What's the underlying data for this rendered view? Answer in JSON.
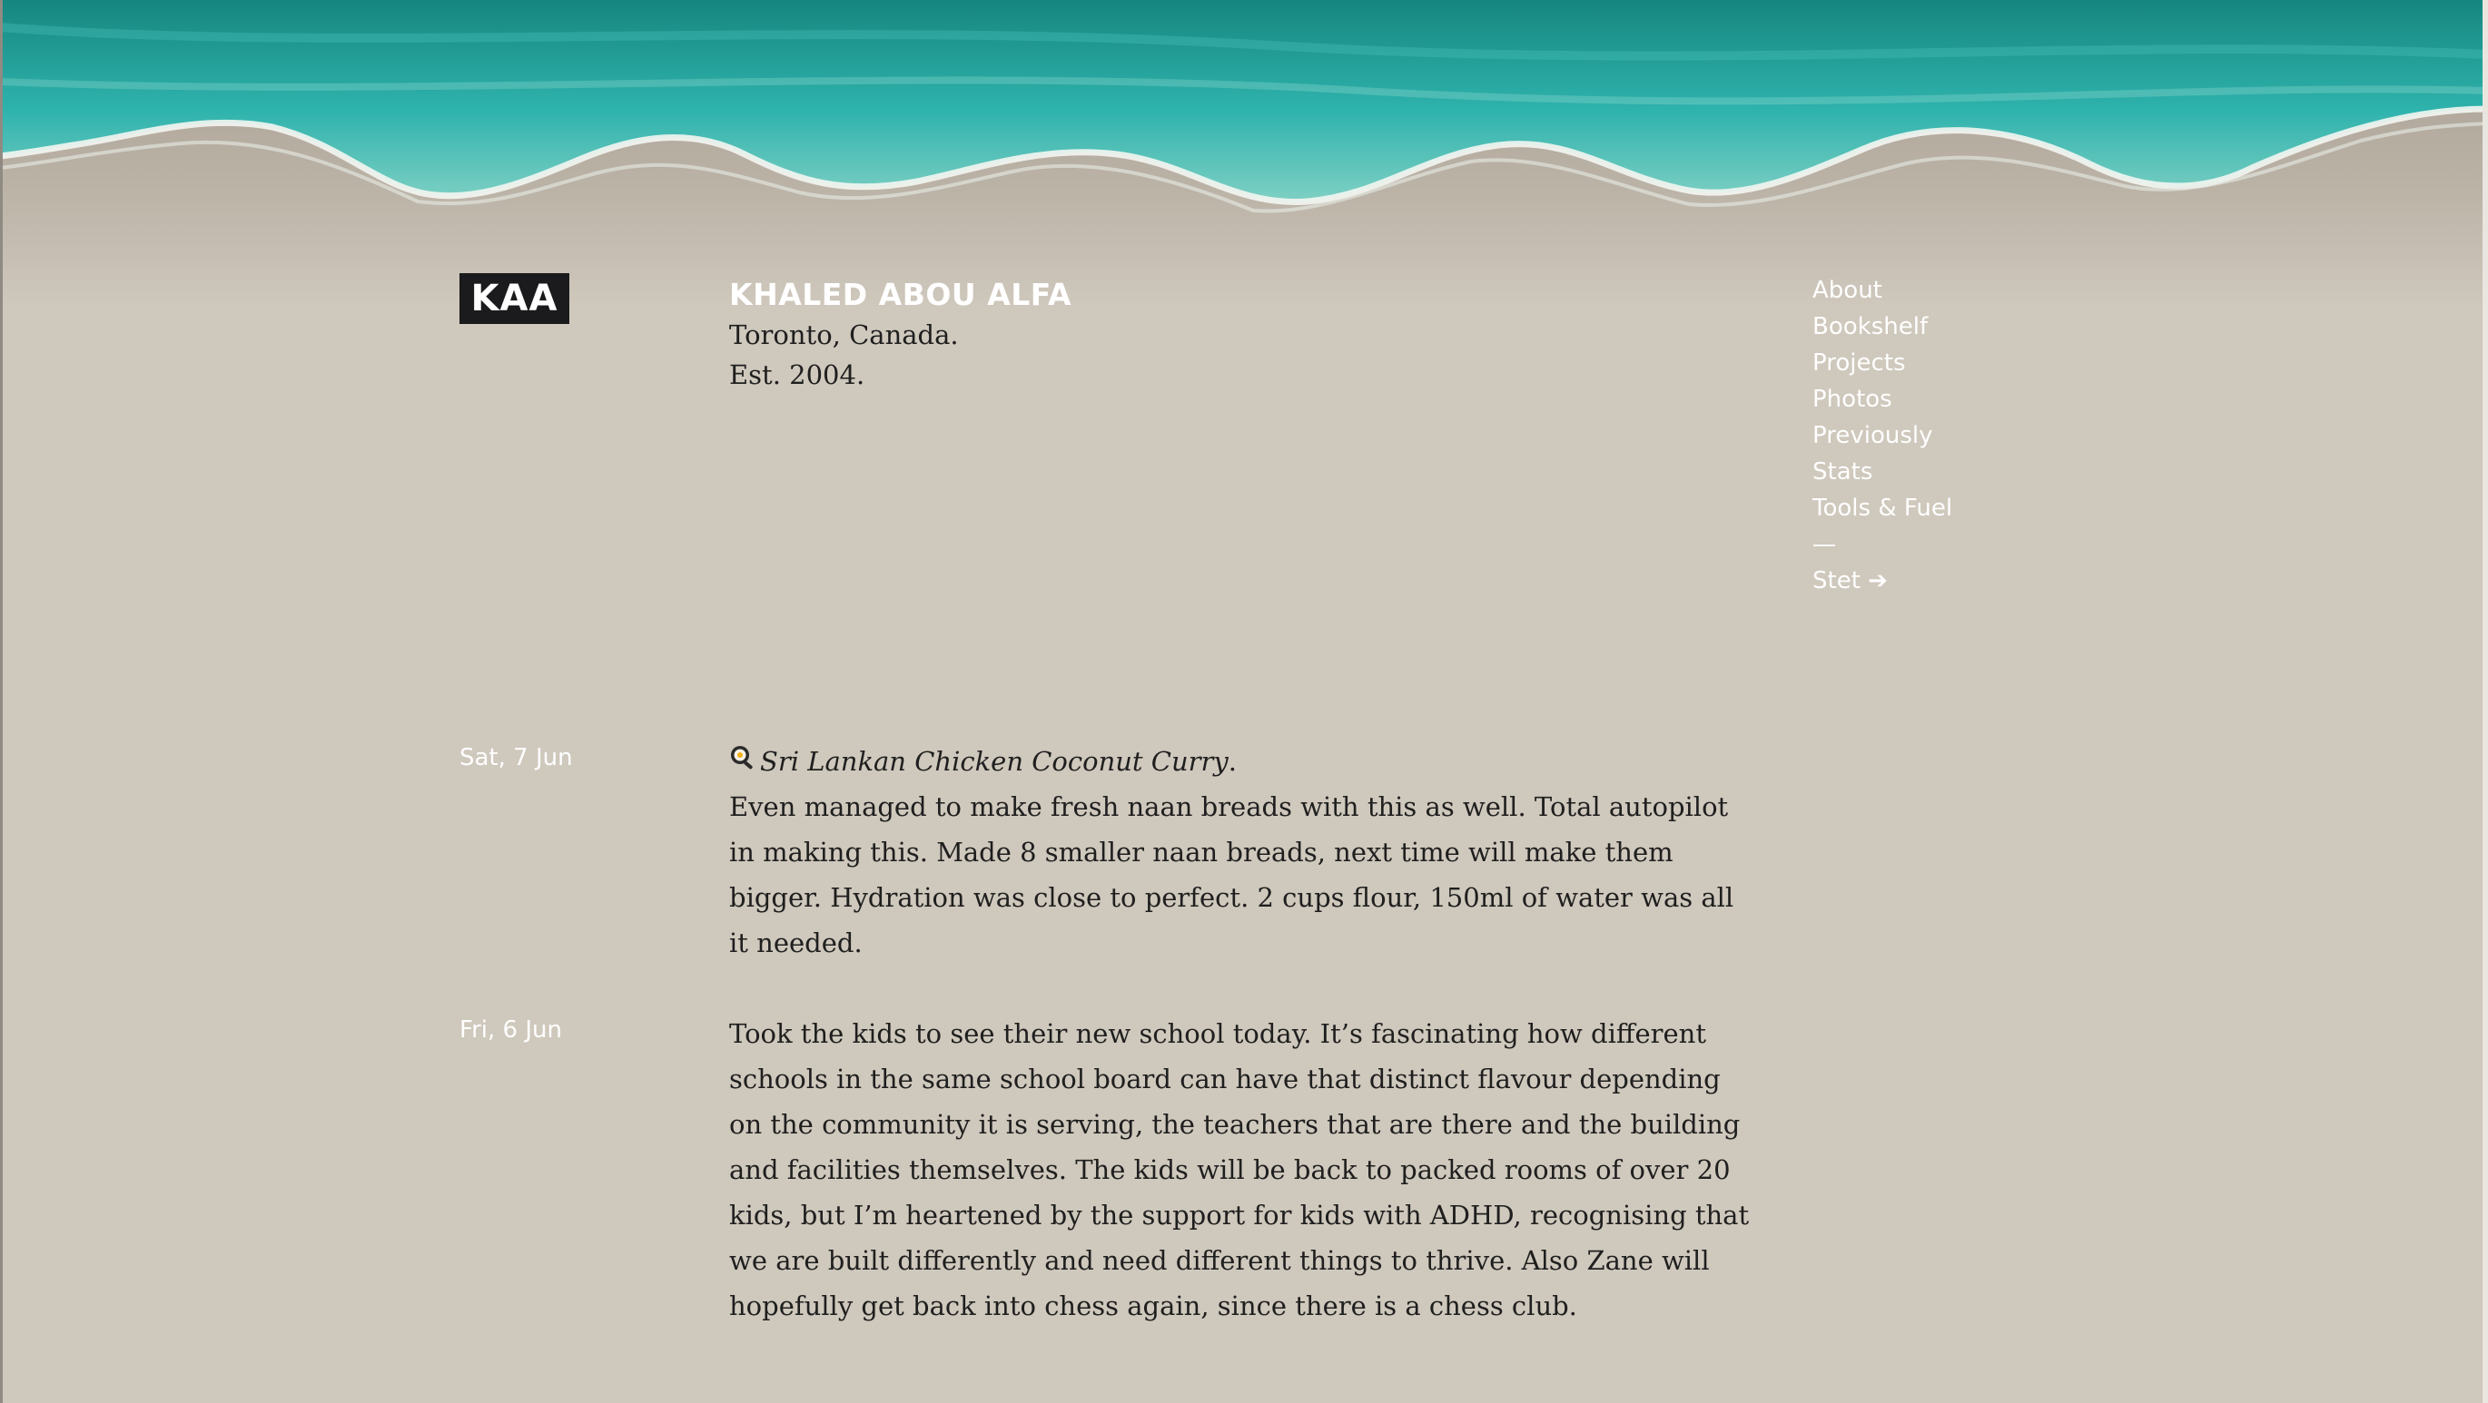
{
  "header": {
    "logo": "KAA",
    "name": "KHALED ABOU ALFA",
    "location": "Toronto, Canada.",
    "established": "Est. 2004."
  },
  "nav": {
    "items": [
      "About",
      "Bookshelf",
      "Projects",
      "Photos",
      "Previously",
      "Stats",
      "Tools & Fuel"
    ],
    "divider": "—",
    "external": "Stet ➔"
  },
  "entries": [
    {
      "date": "Sat, 7 Jun",
      "icon": "frying-pan-icon",
      "recipe": "Sri Lankan Chicken Coconut Curry",
      "recipe_suffix": ".",
      "text": "Even managed to make fresh naan breads with this as well. Total autopilot in making this. Made 8 smaller naan breads, next time will make them bigger. Hydration was close to perfect. 2 cups flour, 150ml of water was all it needed."
    },
    {
      "date": "Fri, 6 Jun",
      "text": "Took the kids to see their new school today. It’s fascinating how different schools in the same school board can have that distinct flavour depending on the community it is serving, the teachers that are there and the building and facilities themselves. The kids will be back to packed rooms of over 20 kids, but I’m heartened by the support for kids with ADHD, recognising that we are built differently and need different things to thrive. Also Zane will hopefully get back into chess again, since there is a chess club."
    }
  ],
  "colors": {
    "page_background": "#cfc8bc",
    "sea": "#2aa8a3",
    "sand": "#bfb6aa",
    "logo_background": "#1b1b1d",
    "link": "#ffffff"
  }
}
